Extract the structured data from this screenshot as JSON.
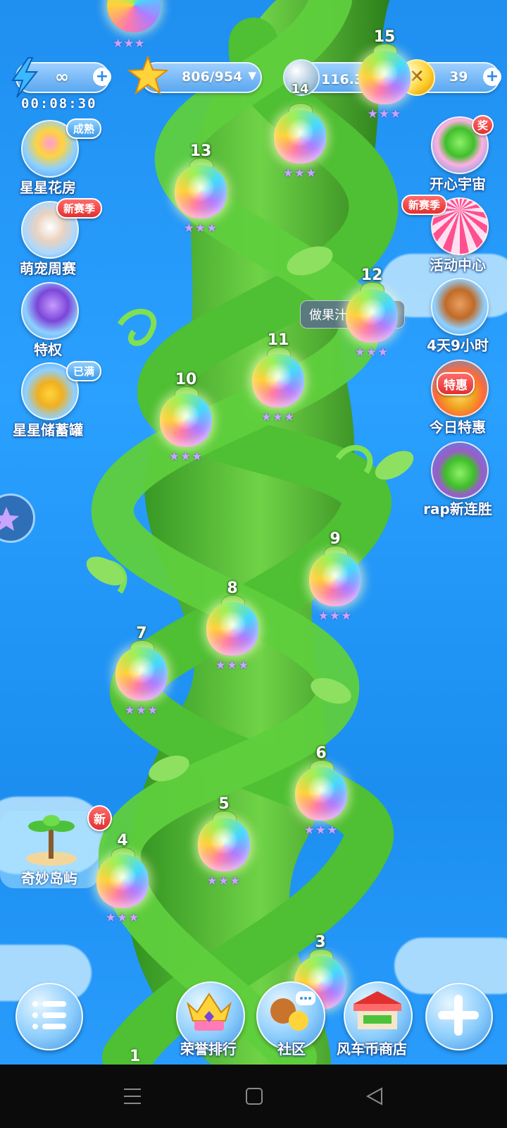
{
  "status_bar": {
    "energy": {
      "value": "∞"
    },
    "timer": "00:08:30",
    "stars": {
      "value": "806/954"
    },
    "pearls": {
      "value": "116.3万"
    },
    "coins": {
      "value": "39"
    }
  },
  "left_menu": [
    {
      "label": "星星花房",
      "tag": "成熟",
      "icon": "flower-house-icon"
    },
    {
      "label": "萌宠周赛",
      "tag": "新赛季",
      "icon": "cat-pet-icon"
    },
    {
      "label": "特权",
      "tag": "",
      "icon": "owl-star-icon"
    },
    {
      "label": "星星储蓄罐",
      "tag": "已满",
      "icon": "piggy-bank-icon"
    }
  ],
  "right_menu": [
    {
      "label": "开心宇宙",
      "tag": "奖",
      "icon": "frog-planet-icon"
    },
    {
      "label": "活动中心",
      "tag": "新赛季",
      "icon": "circus-tent-icon"
    },
    {
      "label": "4天9小时",
      "tag": "",
      "icon": "bear-juice-icon"
    },
    {
      "label": "今日特惠",
      "tag": "特惠",
      "icon": "coin-shop-icon"
    },
    {
      "label": "rap新连胜",
      "tag": "",
      "icon": "rap-frog-icon"
    }
  ],
  "tooltip": "做果汁领奖励~",
  "island": {
    "label": "奇妙岛屿",
    "tag": "新"
  },
  "levels": [
    {
      "num": "15",
      "stars": "★★★"
    },
    {
      "num": "14",
      "stars": "★★★"
    },
    {
      "num": "13",
      "stars": "★★★"
    },
    {
      "num": "12",
      "stars": "★★★"
    },
    {
      "num": "11",
      "stars": "★★★"
    },
    {
      "num": "10",
      "stars": "★★★"
    },
    {
      "num": "9",
      "stars": "★★★"
    },
    {
      "num": "8",
      "stars": "★★★"
    },
    {
      "num": "7",
      "stars": "★★★"
    },
    {
      "num": "6",
      "stars": "★★★"
    },
    {
      "num": "5",
      "stars": "★★★"
    },
    {
      "num": "4",
      "stars": "★★★"
    },
    {
      "num": "3",
      "stars": "★★★"
    },
    {
      "num": "1",
      "stars": ""
    }
  ],
  "top_level_stars": "★★★",
  "bottom_bar": {
    "menu_icon": "list-menu-icon",
    "ranking": "荣誉排行",
    "community": "社区",
    "shop": "风车币商店",
    "add_icon": "plus-icon"
  },
  "colors": {
    "sky": "#2aa0ff",
    "stalk": "#3fae2a",
    "accent_red": "#e23030"
  }
}
